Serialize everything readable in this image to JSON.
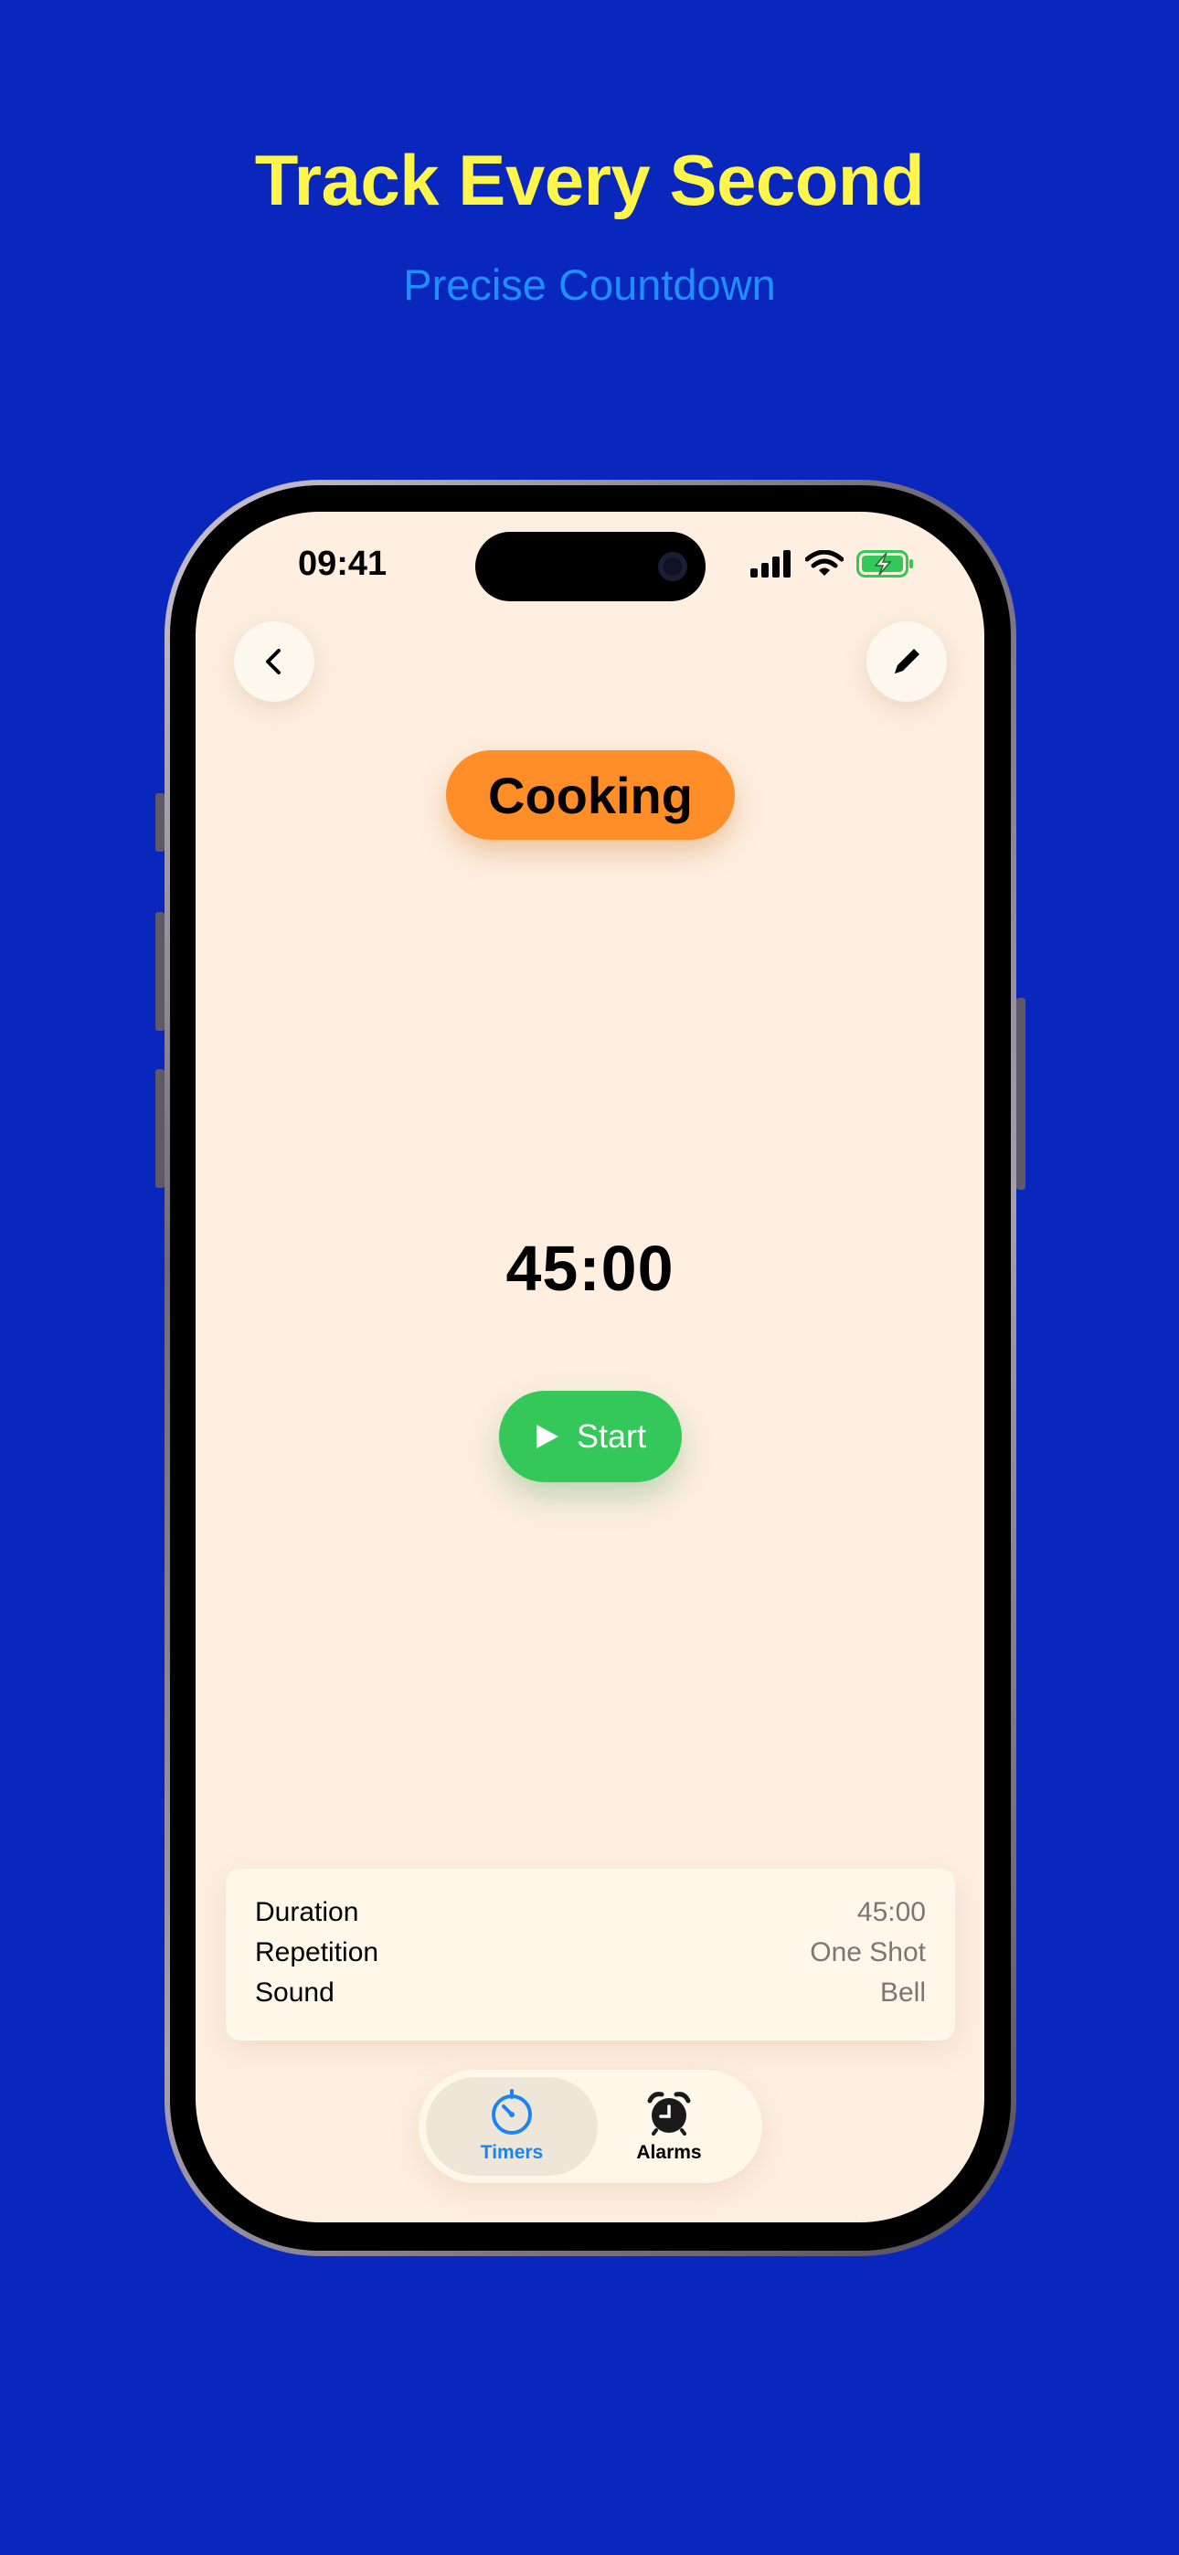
{
  "headline": "Track Every Second",
  "subheadline": "Precise Countdown",
  "status_bar": {
    "time": "09:41",
    "icons": [
      "cellular-signal-icon",
      "wifi-icon",
      "battery-charging-icon"
    ]
  },
  "nav": {
    "back_icon": "chevron-left-icon",
    "edit_icon": "pencil-icon"
  },
  "timer": {
    "name": "Cooking",
    "countdown": "45:00",
    "start_label": "Start"
  },
  "details": [
    {
      "label": "Duration",
      "value": "45:00"
    },
    {
      "label": "Repetition",
      "value": "One Shot"
    },
    {
      "label": "Sound",
      "value": "Bell"
    }
  ],
  "tabs": [
    {
      "label": "Timers",
      "icon": "stopwatch-icon",
      "active": true
    },
    {
      "label": "Alarms",
      "icon": "alarm-clock-icon",
      "active": false
    }
  ],
  "colors": {
    "background": "#0A27BD",
    "headline": "#FFF54B",
    "subheadline": "#1E8FFF",
    "screen": "#FEEFE1",
    "timer_pill": "#FF8E28",
    "start_button": "#34C759",
    "active_tab": "#1C84F0"
  }
}
